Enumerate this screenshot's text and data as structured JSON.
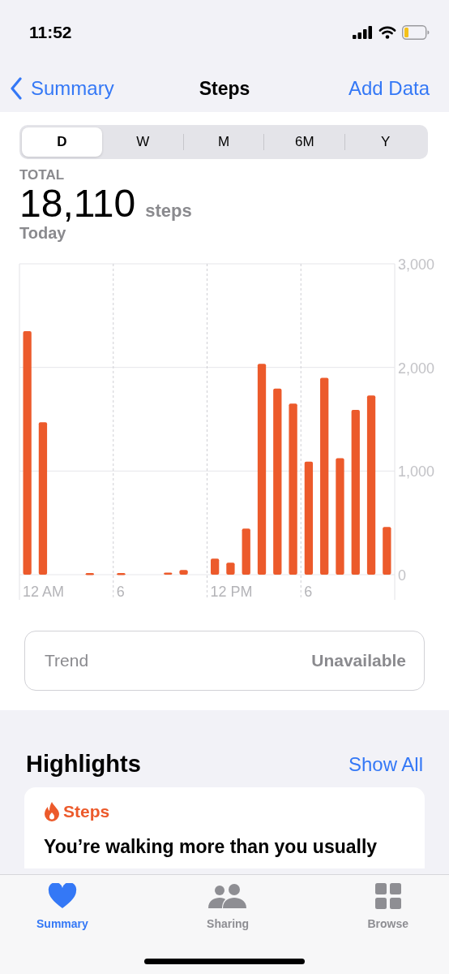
{
  "status_bar": {
    "time": "11:52"
  },
  "nav": {
    "back": "Summary",
    "title": "Steps",
    "action": "Add Data"
  },
  "periods": [
    {
      "label": "D",
      "selected": true
    },
    {
      "label": "W",
      "selected": false
    },
    {
      "label": "M",
      "selected": false
    },
    {
      "label": "6M",
      "selected": false
    },
    {
      "label": "Y",
      "selected": false
    }
  ],
  "summary": {
    "caption": "TOTAL",
    "value": "18,110",
    "unit": "steps",
    "date": "Today"
  },
  "chart_data": {
    "type": "bar",
    "series": [
      {
        "color": "#ec5a2b",
        "values": [
          2350,
          1470,
          0,
          0,
          15,
          0,
          15,
          0,
          0,
          20,
          45,
          0,
          155,
          115,
          445,
          2035,
          1795,
          1650,
          1090,
          1900,
          1125,
          1590,
          1730,
          460
        ]
      }
    ],
    "ylim": [
      0,
      3000
    ],
    "yticks": [
      {
        "value": 0,
        "label": "0"
      },
      {
        "value": 1000,
        "label": "1,000"
      },
      {
        "value": 2000,
        "label": "2,000"
      },
      {
        "value": 3000,
        "label": "3,000"
      }
    ]
  },
  "time_labels": [
    "12 AM",
    "6",
    "12 PM",
    "6"
  ],
  "trend": {
    "label": "Trend",
    "value": "Unavailable"
  },
  "highlights": {
    "title": "Highlights",
    "action": "Show All",
    "card": {
      "category": "Steps",
      "text": "You’re walking more than you usually"
    }
  },
  "tab_bar": [
    {
      "label": "Summary",
      "kind": "heart",
      "selected": true
    },
    {
      "label": "Sharing",
      "kind": "people",
      "selected": false
    },
    {
      "label": "Browse",
      "kind": "grid",
      "selected": false
    }
  ]
}
